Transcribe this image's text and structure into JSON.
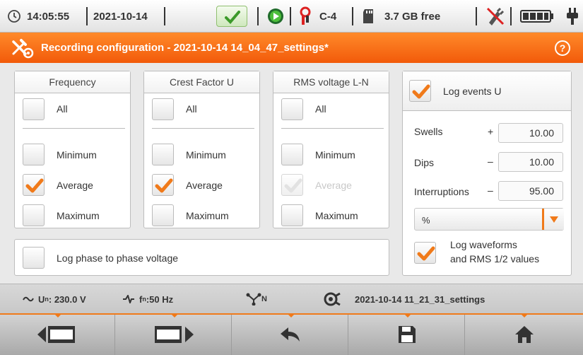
{
  "status": {
    "time": "14:05:55",
    "date": "2021-10-14",
    "connection": "C-4",
    "storage": "3.7 GB free",
    "icons": [
      "clock-icon",
      "checkmark-icon",
      "play-record-icon",
      "pliers-icon",
      "sd-card-icon",
      "no-mains-icon",
      "battery-icon",
      "plug-icon"
    ]
  },
  "title": "Recording configuration - 2021-10-14 14_04_47_settings*",
  "panels": {
    "frequency": {
      "header": "Frequency",
      "all": {
        "label": "All",
        "checked": false
      },
      "minimum": {
        "label": "Minimum",
        "checked": false
      },
      "average": {
        "label": "Average",
        "checked": true
      },
      "maximum": {
        "label": "Maximum",
        "checked": false
      }
    },
    "crest": {
      "header": "Crest Factor U",
      "all": {
        "label": "All",
        "checked": false
      },
      "minimum": {
        "label": "Minimum",
        "checked": false
      },
      "average": {
        "label": "Average",
        "checked": true
      },
      "maximum": {
        "label": "Maximum",
        "checked": false
      }
    },
    "rms": {
      "header": "RMS voltage L-N",
      "all": {
        "label": "All",
        "checked": false
      },
      "minimum": {
        "label": "Minimum",
        "checked": false
      },
      "average": {
        "label": "Average",
        "checked": true,
        "disabled": true
      },
      "maximum": {
        "label": "Maximum",
        "checked": false
      }
    }
  },
  "log_phase": {
    "label": "Log phase to phase voltage",
    "checked": false
  },
  "events": {
    "header": "Log events U",
    "checked": true,
    "swells": {
      "label": "Swells",
      "sign": "+",
      "value": "10.00"
    },
    "dips": {
      "label": "Dips",
      "sign": "–",
      "value": "10.00"
    },
    "interruptions": {
      "label": "Interruptions",
      "sign": "–",
      "value": "95.00"
    },
    "unit": "%",
    "waveforms": {
      "line1": "Log waveforms",
      "line2": "and RMS 1/2 values",
      "checked": true
    }
  },
  "info": {
    "un_label": "U",
    "un_sub": "n",
    "un_value": ": 230.0 V",
    "fn_label": "f",
    "fn_sub": "n",
    "fn_value": ":50 Hz",
    "network_sub": "N",
    "settings": "2021-10-14 11_21_31_settings"
  },
  "colors": {
    "accent": "#f07a1a",
    "check": "#f07a1a",
    "disabled_check": "#d8d8d8"
  }
}
